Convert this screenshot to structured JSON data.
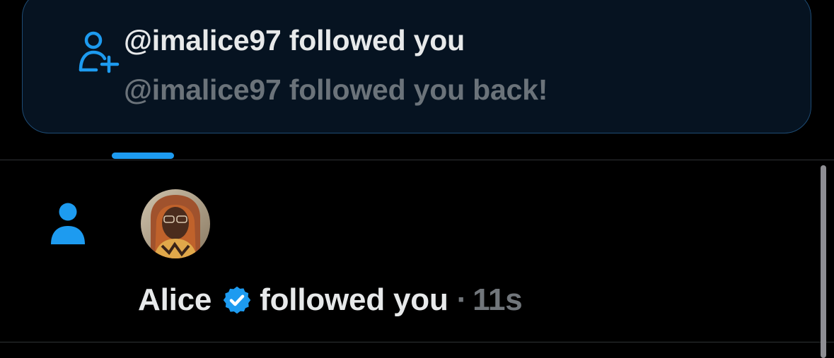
{
  "toast": {
    "title": "@imalice97 followed you",
    "subtitle": "@imalice97 followed you back!",
    "icon": "person-plus-icon"
  },
  "notification": {
    "icon": "person-icon",
    "name": "Alice",
    "badge": "verified-badge-icon",
    "action": "followed you",
    "separator": "·",
    "time": "11s"
  },
  "colors": {
    "accent": "#1d9bf0",
    "background": "#000000",
    "toast_background": "#061321",
    "toast_border": "#1e4c75",
    "text_primary": "#e7e9ea",
    "text_secondary": "#71767b"
  }
}
